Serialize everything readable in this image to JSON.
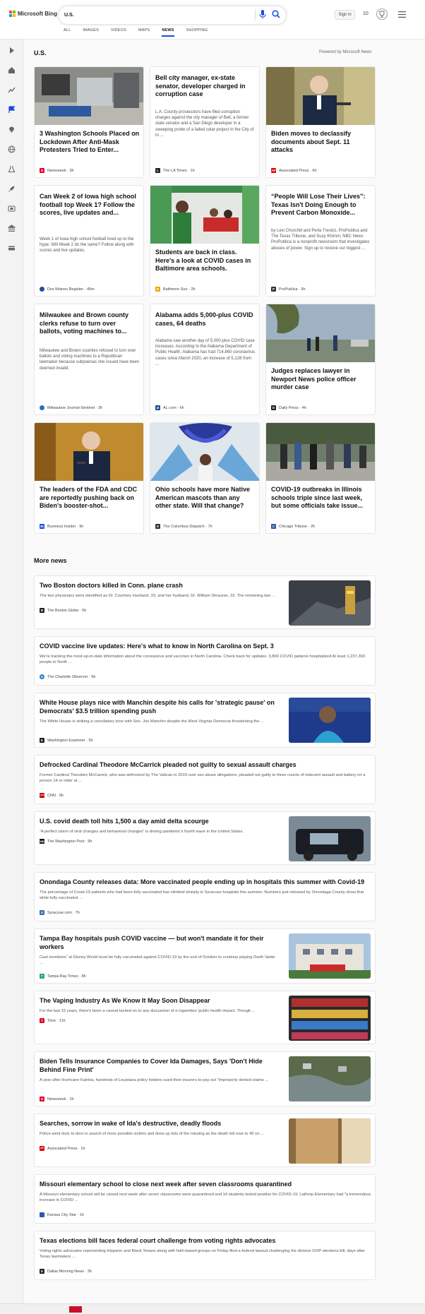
{
  "header": {
    "brand": "Microsoft Bing",
    "search_value": "U.S.",
    "sign_in": "Sign in",
    "rewards_count": "10",
    "tabs": [
      "ALL",
      "IMAGES",
      "VIDEOS",
      "MAPS",
      "NEWS",
      "SHOPPING"
    ],
    "active_tab": "NEWS"
  },
  "section": {
    "title": "U.S.",
    "powered_by": "Powered by Microsoft News"
  },
  "cards": [
    {
      "title": "3 Washington Schools Placed on Lockdown After Anti-Mask Protesters Tried to Enter...",
      "desc": "",
      "source": "Newsweek",
      "time": "3h",
      "icon": "N",
      "icon_color": "#e4002b"
    },
    {
      "title": "Bell city manager, ex-state senator, developer charged in corruption case",
      "desc": "L.A. County prosecutors have filed corruption charges against the city manager of Bell, a former state senator and a San Diego developer in a sweeping probe of a failed solar project in the City of In ...",
      "source": "The LA Times",
      "time": "1h",
      "icon": "L",
      "icon_color": "#222222"
    },
    {
      "title": "Biden moves to declassify documents about Sept. 11 attacks",
      "desc": "",
      "source": "Associated Press",
      "time": "6h",
      "icon": "AP",
      "icon_color": "#e00000"
    },
    {
      "title": "Can Week 2 of Iowa high school football top Week 1? Follow the scores, live updates and...",
      "desc": "Week 1 of Iowa high school football lived up to the hype. Will Week 2 do the same? Follow along with scores and live updates.",
      "source": "Des Moines Register",
      "time": "45m",
      "icon": "",
      "icon_color": "#1f4e9c"
    },
    {
      "title": "Students are back in class. Here's a look at COVID cases in Baltimore area schools.",
      "desc": "",
      "source": "Baltimore Sun",
      "time": "2h",
      "icon": "B",
      "icon_color": "#f0a500"
    },
    {
      "title": "“People Will Lose Their Lives”: Texas Isn't Doing Enough to Prevent Carbon Monoxide...",
      "desc": "by Lexi Churchill and Perla Trevizo, ProPublica and The Texas Tribune, and Suzy Khimm, NBC News ProPublica is a nonprofit newsroom that investigates abuses of power. Sign up to receive our biggest ...",
      "source": "ProPublica",
      "time": "5h",
      "icon": "P",
      "icon_color": "#333333"
    },
    {
      "title": "Milwaukee and Brown county clerks refuse to turn over ballots, voting machines to...",
      "desc": "Milwaukee and Brown counties refused to turn over ballots and voting machines to a Republican lawmaker because subpoenas she issued have been deemed invalid.",
      "source": "Milwaukee Journal-Sentinel",
      "time": "3h",
      "icon": "",
      "icon_color": "#2a6ebb"
    },
    {
      "title": "Alabama adds 5,000-plus COVID cases, 64 deaths",
      "desc": "Alabama saw another day of 5,000-plus COVID case increases. According to the Alabama Department of Public Health, Alabama has had 714,860 coronavirus cases since March 2020, an increase of 5,128 from ...",
      "source": "AL.com",
      "time": "6h",
      "icon": "al",
      "icon_color": "#1c4d8c"
    },
    {
      "title": "Judges replaces lawyer in Newport News police officer murder case",
      "desc": "",
      "source": "Daily Press",
      "time": "4h",
      "icon": "D",
      "icon_color": "#222222"
    },
    {
      "title": "The leaders of the FDA and CDC are reportedly pushing back on Biden's booster-shot...",
      "desc": "",
      "source": "Business Insider",
      "time": "9h",
      "icon": "BI",
      "icon_color": "#1a4ee8"
    },
    {
      "title": "Ohio schools have more Native American mascots than any other state. Will that change?",
      "desc": "",
      "source": "The Columbus Dispatch",
      "time": "7h",
      "icon": "D",
      "icon_color": "#333333"
    },
    {
      "title": "COVID-19 outbreaks in Illinois schools triple since last week, but some officials take issue...",
      "desc": "",
      "source": "Chicago Tribune",
      "time": "2h",
      "icon": "C",
      "icon_color": "#2a5aa8"
    }
  ],
  "more_news": {
    "title": "More news",
    "items": [
      {
        "title": "Two Boston doctors killed in Conn. plane crash",
        "desc": "The two physicians were identified as Dr. Courtney Haviland, 33, and her husband, Dr. William Shrauner, 32. The remaining two ...",
        "source": "The Boston Globe",
        "time": "5h",
        "icon": "B",
        "icon_color": "#222222"
      },
      {
        "title": "COVID vaccine live updates: Here's what to know in North Carolina on Sept. 3",
        "desc": "We're tracking the most-up-to-date information about the coronavirus and vaccines in North Carolina. Check back for updates. 3,800 COVID patients hospitalized At least 1,237,393 people in North ...",
        "source": "The Charlotte Observer",
        "time": "5h",
        "icon": "O",
        "icon_color": "#2a7bd0"
      },
      {
        "title": "White House plays nice with Manchin despite his calls for 'strategic pause' on Democrats' $3.5 trillion spending push",
        "desc": "The White House is striking a conciliatory tone with Sen. Joe Manchin despite the West Virginia Democrat threatening the ...",
        "source": "Washington Examiner",
        "time": "5h",
        "icon": "E",
        "icon_color": "#222222"
      },
      {
        "title": "Defrocked Cardinal Theodore McCarrick pleaded not guilty to sexual assault charges",
        "desc": "Former Cardinal Theodore McCarrick, who was defrocked by The Vatican in 2019 over sex abuse allegations, pleaded not guilty to three counts of indecent assault and battery on a person 14 or older at ...",
        "source": "CNN",
        "time": "9h",
        "icon": "CNN",
        "icon_color": "#cc0000"
      },
      {
        "title": "U.S. covid death toll hits 1,500 a day amid delta scourge",
        "desc": "“A perfect storm of viral changes and behavioral changes” is driving pandemic's fourth wave in the United States.",
        "source": "The Washington Post",
        "time": "9h",
        "icon": "wp",
        "icon_color": "#111111"
      },
      {
        "title": "Onondaga County releases data: More vaccinated people ending up in hospitals this summer with Covid-19",
        "desc": "The percentage of Covid-19 patients who had been fully vaccinated has climbed sharply in Syracuse hospitals this summer. Numbers just released by Onondaga County show that while fully vaccinated ...",
        "source": "Syracuse.com",
        "time": "7h",
        "icon": "S",
        "icon_color": "#3a6fb6"
      },
      {
        "title": "Tampa Bay hospitals push COVID vaccine — but won't mandate it for their workers",
        "desc": "Cast members” at Disney World must be fully vaccinated against COVID-19 by the end of October to continue playing Darth Vader ...",
        "source": "Tampa Bay Times",
        "time": "8h",
        "icon": "T",
        "icon_color": "#2aa37a"
      },
      {
        "title": "The Vaping Industry As We Know It May Soon Disappear",
        "desc": "For the last 15 years, there's been a caveat tacked on to any discussion of e-cigarettes' public health impact. Though ...",
        "source": "Time",
        "time": "11h",
        "icon": "T",
        "icon_color": "#e4002b"
      },
      {
        "title": "Biden Tells Insurance Companies to Cover Ida Damages, Says 'Don't Hide Behind Fine Print'",
        "desc": "A year after Hurricane Katrina, hundreds of Louisiana policy holders sued their insurers to pay out \"improperly denied claims ...",
        "source": "Newsweek",
        "time": "1h",
        "icon": "N",
        "icon_color": "#e4002b"
      },
      {
        "title": "Searches, sorrow in wake of Ida's destructive, deadly floods",
        "desc": "Police went door to door in search of more possible victims and drew up lists of the missing as the death toll rose to 45 on ...",
        "source": "Associated Press",
        "time": "1h",
        "icon": "AP",
        "icon_color": "#e00000"
      },
      {
        "title": "Missouri elementary school to close next week after seven classrooms quarantined",
        "desc": "A Missouri elementary school will be closed next week after seven classrooms were quarantined and 14 students tested positive for COVID-19. Lathrop Elementary had \"a tremendous increase in COVID ...",
        "source": "Kansas City Star",
        "time": "1h",
        "icon": "",
        "icon_color": "#2a5aa8"
      },
      {
        "title": "Texas elections bill faces federal court challenge from voting rights advocates",
        "desc": "Voting rights advocates representing Hispanic and Black Texans along with faith-based groups on Friday filed a federal lawsuit challenging the divisive GOP elections bill, days after Texas lawmakers ...",
        "source": "Dallas Morning News",
        "time": "3h",
        "icon": "D",
        "icon_color": "#222222"
      }
    ]
  }
}
